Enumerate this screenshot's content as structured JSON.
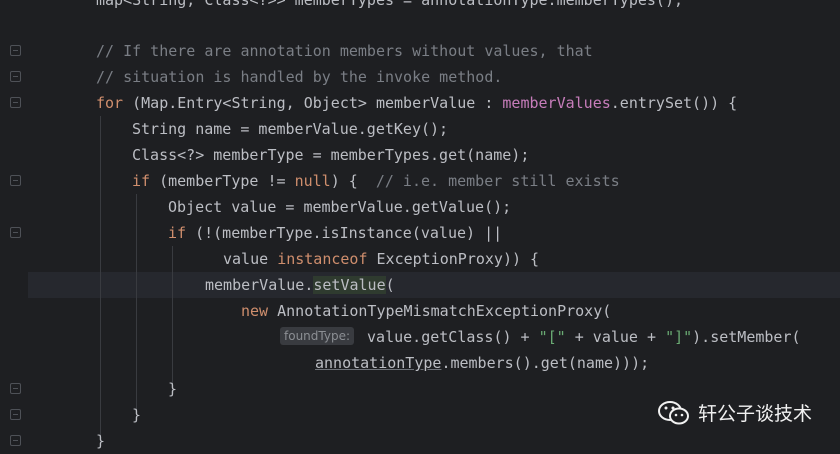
{
  "lines": {
    "l0": "map<String, Class<?>> memberTypes = annotationType.memberTypes();",
    "l1": "// If there are annotation members without values, that",
    "l2": "// situation is handled by the invoke method.",
    "l3_kw": "for",
    "l3_a": " (Map.Entry<String, Object> memberValue : ",
    "l3_fld": "memberValues",
    "l3_b": ".entrySet()) {",
    "l4": "String name = memberValue.getKey();",
    "l5": "Class<?> memberType = memberTypes.get(name);",
    "l6_kw": "if",
    "l6_a": " (memberType != ",
    "l6_null": "null",
    "l6_b": ") {  ",
    "l6_cm": "// i.e. member still exists",
    "l7": "Object value = memberValue.getValue();",
    "l8_kw": "if",
    "l8_a": " (!(memberType.isInstance(value) ||",
    "l9_a": "value ",
    "l9_kw": "instanceof",
    "l9_b": " ExceptionProxy)) {",
    "l10_a": "memberValue.",
    "l10_b": "setValue",
    "l10_c": "(",
    "l11_kw": "new",
    "l11_a": " AnnotationTypeMismatchExceptionProxy(",
    "l12_hint": "foundType:",
    "l12_a": " value.getClass() + ",
    "l12_s1": "\"[\"",
    "l12_b": " + value + ",
    "l12_s2": "\"]\"",
    "l12_c": ").setMember(",
    "l13_a": "annotationType",
    "l13_b": ".members().get(name)));",
    "l14": "}",
    "l15": "}",
    "l16": "}"
  },
  "watermark": {
    "text": "轩公子谈技术",
    "icon": "wechat-icon"
  },
  "colors": {
    "keyword": "#cf8e6d",
    "comment": "#7a7e85",
    "string": "#6aab73",
    "field": "#c77dbb",
    "text": "#bcbec4",
    "background": "#1e1f22"
  }
}
